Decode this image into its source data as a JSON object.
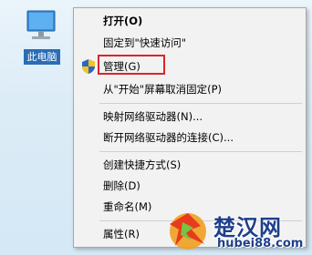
{
  "desktop": {
    "icon_name": "computer-icon",
    "label": "此电脑"
  },
  "context_menu": {
    "groups": [
      [
        {
          "label": "打开(O)",
          "bold": true
        },
        {
          "label": "固定到\"快速访问\""
        },
        {
          "label": "管理(G)",
          "icon": "shield-icon",
          "highlighted": true
        },
        {
          "label": "从\"开始\"屏幕取消固定(P)"
        }
      ],
      [
        {
          "label": "映射网络驱动器(N)..."
        },
        {
          "label": "断开网络驱动器的连接(C)..."
        }
      ],
      [
        {
          "label": "创建快捷方式(S)"
        },
        {
          "label": "删除(D)"
        },
        {
          "label": "重命名(M)"
        }
      ],
      [
        {
          "label": "属性(R)"
        }
      ]
    ]
  },
  "annotation": {
    "color": "#d9252a",
    "target": "管理(G)"
  },
  "watermark": {
    "title": "楚汉网",
    "url": "hubei88.com"
  },
  "colors": {
    "menu_bg": "#f2f2f2",
    "selection_label_bg": "#2a6db5",
    "watermark_text": "#1f3f8a"
  }
}
